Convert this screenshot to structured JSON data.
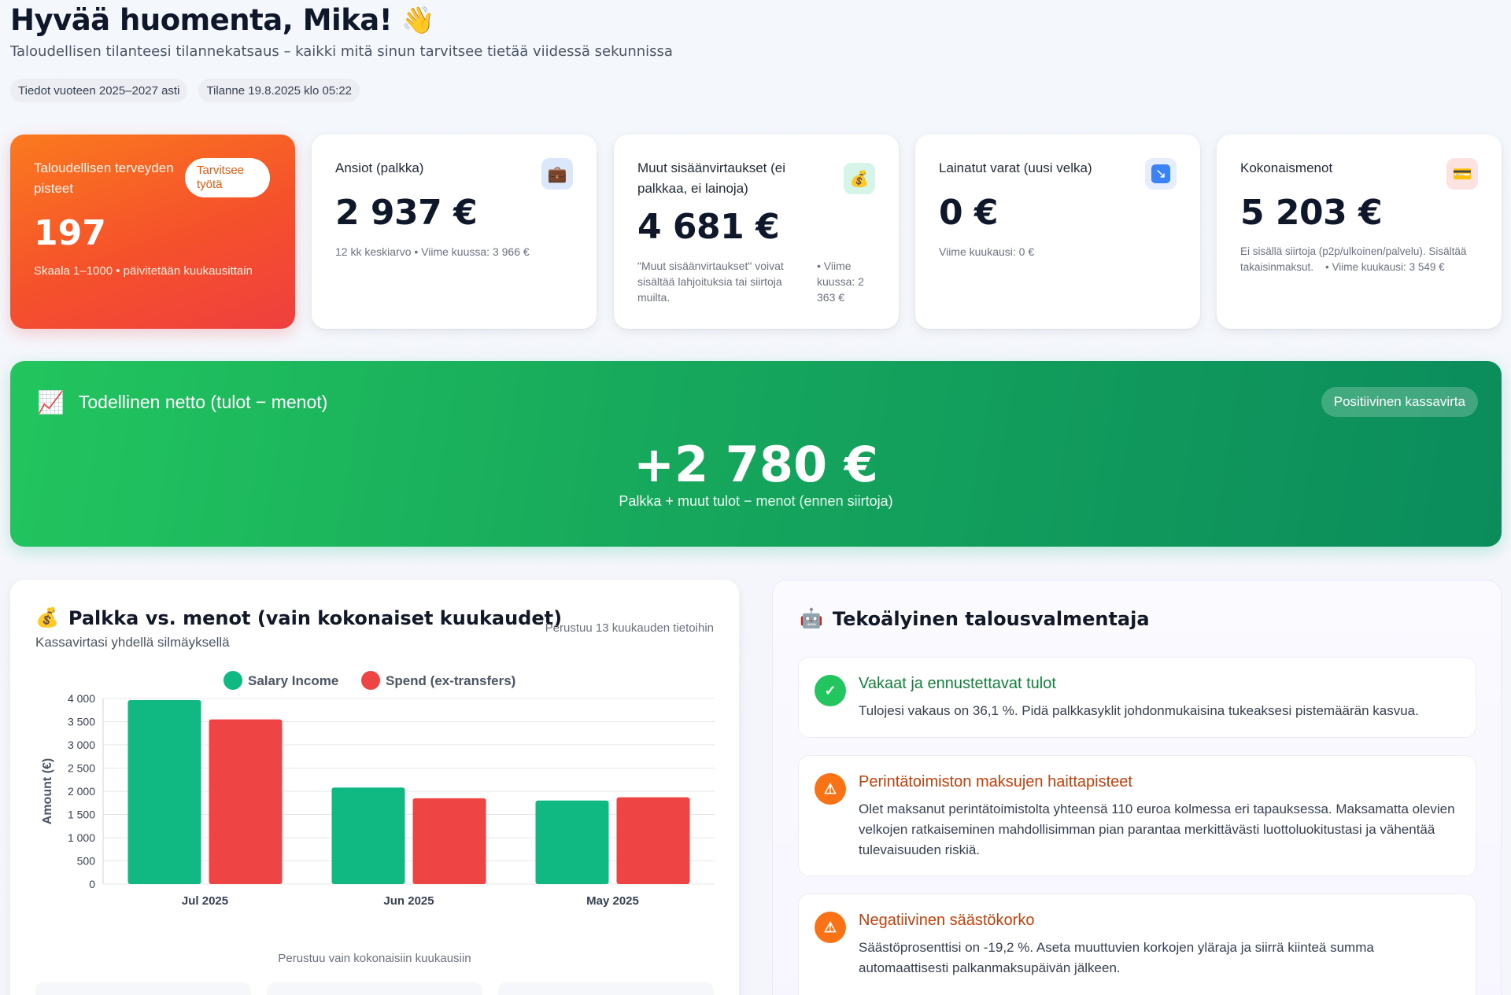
{
  "header": {
    "greeting": "Hyvää huomenta, Mika!",
    "wave_icon": "👋",
    "subtitle": "Taloudellisen tilanteesi tilannekatsaus – kaikki mitä sinun tarvitsee tietää viidessä sekunnissa",
    "chip_years": "Tiedot vuoteen 2025–2027 asti",
    "chip_status": "Tilanne 19.8.2025 klo 05:22"
  },
  "health": {
    "title": "Taloudellisen terveyden pisteet",
    "badge": "Tarvitsee työtä",
    "score": "197",
    "scale": "Skaala 1–1000 • päivitetään kuukausittain"
  },
  "cards": {
    "earnings": {
      "title": "Ansiot (palkka)",
      "icon": "💼",
      "icon_name": "briefcase-icon",
      "value": "2 937 €",
      "note": "12 kk keskiarvo • Viime kuussa: 3 966 €"
    },
    "other": {
      "title": "Muut sisäänvirtaukset (ei palkkaa, ei lainoja)",
      "icon": "💰",
      "icon_name": "money-bag-icon",
      "value": "4 681 €",
      "note_left": "\"Muut sisäänvirtaukset\" voivat sisältää lahjoituksia tai siirtoja muilta.",
      "note_right": "• Viime kuussa: 2 363 €"
    },
    "loans": {
      "title": "Lainatut varat (uusi velka)",
      "icon": "↘",
      "icon_name": "arrow-down-right-icon",
      "value": "0 €",
      "note": "Viime kuukausi: 0 €"
    },
    "spend": {
      "title": "Kokonaismenot",
      "icon": "💳",
      "icon_name": "credit-card-icon",
      "value": "5 203 €",
      "note": "Ei sisällä siirtoja (p2p/ulkoinen/palvelu). Sisältää takaisinmaksut.    • Viime kuukausi: 3 549 €"
    }
  },
  "netto": {
    "icon": "📈",
    "title": "Todellinen netto (tulot − menot)",
    "badge": "Positiivinen kassavirta",
    "value": "+2 780 €",
    "sub": "Palkka + muut tulot − menot (ennen siirtoja)"
  },
  "chart_panel": {
    "icon": "💰",
    "title": "Palkka vs. menot (vain kokonaiset kuukaudet)",
    "subtitle": "Kassavirtasi yhdellä silmäyksellä",
    "meta": "Perustuu 13 kuukauden tietoihin",
    "footnote": "Perustuu vain kokonaisiin kuukausiin"
  },
  "chart_data": {
    "type": "bar",
    "categories": [
      "Jul 2025",
      "Jun 2025",
      "May 2025"
    ],
    "series": [
      {
        "name": "Salary Income",
        "color": "#10b981",
        "values": [
          3966,
          2080,
          1800
        ]
      },
      {
        "name": "Spend (ex-transfers)",
        "color": "#ef4444",
        "values": [
          3549,
          1850,
          1870
        ]
      }
    ],
    "ylabel": "Amount (€)",
    "ylim": [
      0,
      4000
    ],
    "yticks": [
      0,
      500,
      1000,
      1500,
      2000,
      2500,
      3000,
      3500,
      4000
    ],
    "ytick_labels": [
      "0",
      "500",
      "1 000",
      "1 500",
      "2 000",
      "2 500",
      "3 000",
      "3 500",
      "4 000"
    ],
    "legend_position": "top",
    "grid": true
  },
  "ai": {
    "icon": "🤖",
    "title": "Tekoälyinen talousvalmentaja",
    "tips": [
      {
        "title": "Vakaat ja ennustettavat tulot",
        "body": "Tulojesi vakaus on 36,1 %. Pidä palkkasyklit johdonmukaisina tukeaksesi pistemäärän kasvua.",
        "color": "#16a34a",
        "icon": "✓"
      },
      {
        "title": "Perintätoimiston maksujen haittapisteet",
        "body": "Olet maksanut perintätoimistolta yhteensä 110 euroa kolmessa eri tapauksessa. Maksamatta olevien velkojen ratkaiseminen mahdollisimman pian parantaa merkittävästi luottoluokitustasi ja vähentää tulevaisuuden riskiä.",
        "color": "#ea580c",
        "icon": "⚠"
      },
      {
        "title": "Negatiivinen säästökorko",
        "body": "Säästöprosenttisi on -19,2 %. Aseta muuttuvien korkojen yläraja ja siirrä kiinteä summa automaattisesti palkanmaksupäivän jälkeen.",
        "color": "#ea580c",
        "icon": "⚠"
      }
    ]
  }
}
